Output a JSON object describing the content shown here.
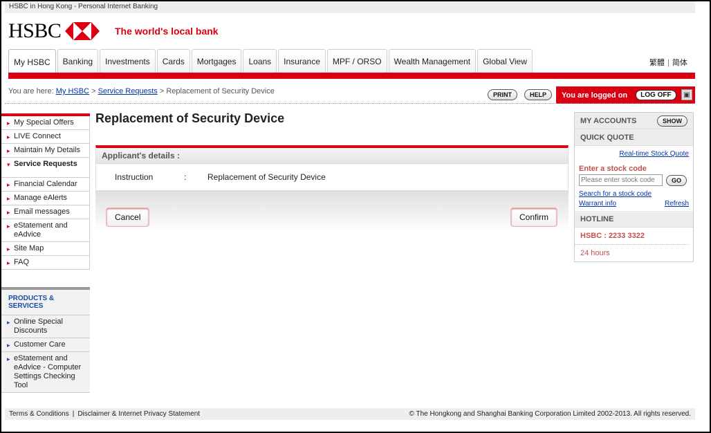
{
  "topbar": {
    "text": "HSBC in Hong Kong - Personal Internet Banking"
  },
  "brand": {
    "logo_text": "HSBC",
    "tagline": "The world's local bank",
    "accent": "#db0011"
  },
  "tabs": [
    {
      "label": "My HSBC",
      "active": true
    },
    {
      "label": "Banking"
    },
    {
      "label": "Investments"
    },
    {
      "label": "Cards"
    },
    {
      "label": "Mortgages"
    },
    {
      "label": "Loans"
    },
    {
      "label": "Insurance"
    },
    {
      "label": "MPF / ORSO"
    },
    {
      "label": "Wealth Management"
    },
    {
      "label": "Global View"
    }
  ],
  "lang": {
    "traditional": "繁體",
    "separator": "|",
    "simplified": "简体"
  },
  "breadcrumb": {
    "prefix": "You are here:",
    "crumb1": "My HSBC",
    "crumb2": "Service Requests",
    "current": "Replacement of Security Device",
    "arrow": ">"
  },
  "header_actions": {
    "print": "PRINT",
    "help": "HELP",
    "logged_in": "You are logged on",
    "logoff": "LOG OFF"
  },
  "leftnav": [
    {
      "label": "My Special Offers"
    },
    {
      "label": "LIVE Connect"
    },
    {
      "label": "Maintain My Details"
    },
    {
      "label": "Service Requests",
      "open": true
    },
    {
      "label": "Financial Calendar"
    },
    {
      "label": "Manage eAlerts"
    },
    {
      "label": "Email messages"
    },
    {
      "label": "eStatement and eAdvice"
    },
    {
      "label": "Site Map"
    },
    {
      "label": "FAQ"
    }
  ],
  "products": {
    "heading": "PRODUCTS & SERVICES",
    "items": [
      {
        "label": "Online Special Discounts"
      },
      {
        "label": "Customer Care"
      },
      {
        "label": "eStatement and eAdvice - Computer Settings Checking Tool"
      }
    ]
  },
  "main": {
    "title": "Replacement of Security Device",
    "panel_heading": "Applicant's details :",
    "instruction_label": "Instruction",
    "colon": ":",
    "instruction_value": "Replacement of Security Device",
    "cancel": "Cancel",
    "confirm": "Confirm"
  },
  "right": {
    "accounts_title": "MY ACCOUNTS",
    "show": "SHOW",
    "quote_title": "QUICK QUOTE",
    "realtime_link": "Real-time Stock Quote",
    "stock_label": "Enter a stock code",
    "stock_placeholder": "Please enter stock code",
    "go": "GO",
    "search_link": "Search for a stock code",
    "warrant_link": "Warrant info",
    "refresh_link": "Refresh",
    "hotline_title": "HOTLINE",
    "hotline_number": "HSBC : 2233 3322",
    "hours": "24 hours"
  },
  "footer": {
    "terms": "Terms & Conditions",
    "separator": "|",
    "disclaimer": "Disclaimer & Internet Privacy Statement",
    "copyright": "© The Hongkong and Shanghai Banking Corporation Limited 2002-2013. All rights reserved."
  }
}
